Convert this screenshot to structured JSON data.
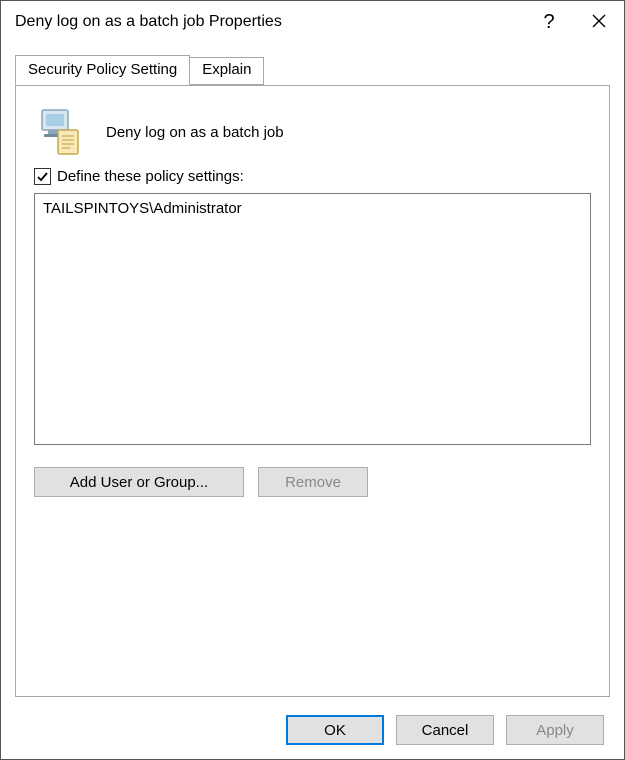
{
  "window": {
    "title": "Deny log on as a batch job Properties"
  },
  "tabs": {
    "security": "Security Policy Setting",
    "explain": "Explain"
  },
  "panel": {
    "policy_name": "Deny log on as a batch job",
    "define_label": "Define these policy settings:",
    "define_checked": true,
    "entries": [
      "TAILSPINTOYS\\Administrator"
    ],
    "add_label": "Add User or Group...",
    "remove_label": "Remove"
  },
  "footer": {
    "ok": "OK",
    "cancel": "Cancel",
    "apply": "Apply"
  }
}
